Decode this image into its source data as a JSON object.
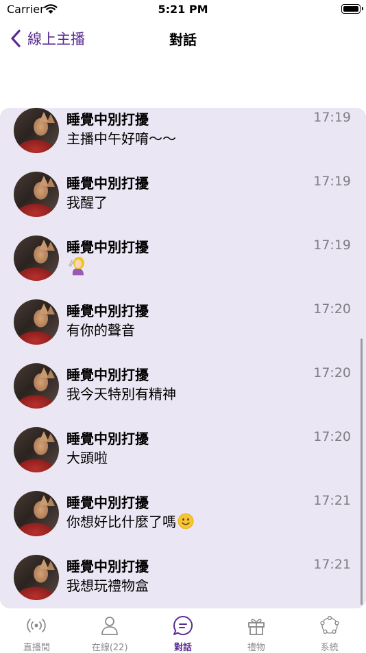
{
  "status_bar": {
    "carrier": "Carrier",
    "time": "5:21 PM"
  },
  "nav": {
    "back_label": "線上主播",
    "title": "對話"
  },
  "messages": [
    {
      "sender": "睡覺中別打擾",
      "time": "17:19",
      "text": "主播中午好唷～～"
    },
    {
      "sender": "睡覺中別打擾",
      "time": "17:19",
      "text": "我醒了"
    },
    {
      "sender": "睡覺中別打擾",
      "time": "17:19",
      "text": "",
      "emoji": "hair-flip-emoji"
    },
    {
      "sender": "睡覺中別打擾",
      "time": "17:20",
      "text": "有你的聲音"
    },
    {
      "sender": "睡覺中別打擾",
      "time": "17:20",
      "text": "我今天特別有精神"
    },
    {
      "sender": "睡覺中別打擾",
      "time": "17:20",
      "text": "大頭啦"
    },
    {
      "sender": "睡覺中別打擾",
      "time": "17:21",
      "text": "你想好比什麼了嗎",
      "emoji": "slightly-smiling-face-emoji"
    },
    {
      "sender": "睡覺中別打擾",
      "time": "17:21",
      "text": "我想玩禮物盒"
    }
  ],
  "tabs": [
    {
      "label": "直播間",
      "icon": "broadcast-icon",
      "active": false
    },
    {
      "label": "在線(22)",
      "icon": "person-icon",
      "active": false
    },
    {
      "label": "對話",
      "icon": "chat-bubble-icon",
      "active": true
    },
    {
      "label": "禮物",
      "icon": "gift-icon",
      "active": false
    },
    {
      "label": "系統",
      "icon": "system-network-icon",
      "active": false
    }
  ],
  "colors": {
    "accent": "#5a2d91",
    "chat_background": "#ebe6f3",
    "inactive_tab": "#8a8a8e",
    "timestamp": "#7d7d85"
  }
}
